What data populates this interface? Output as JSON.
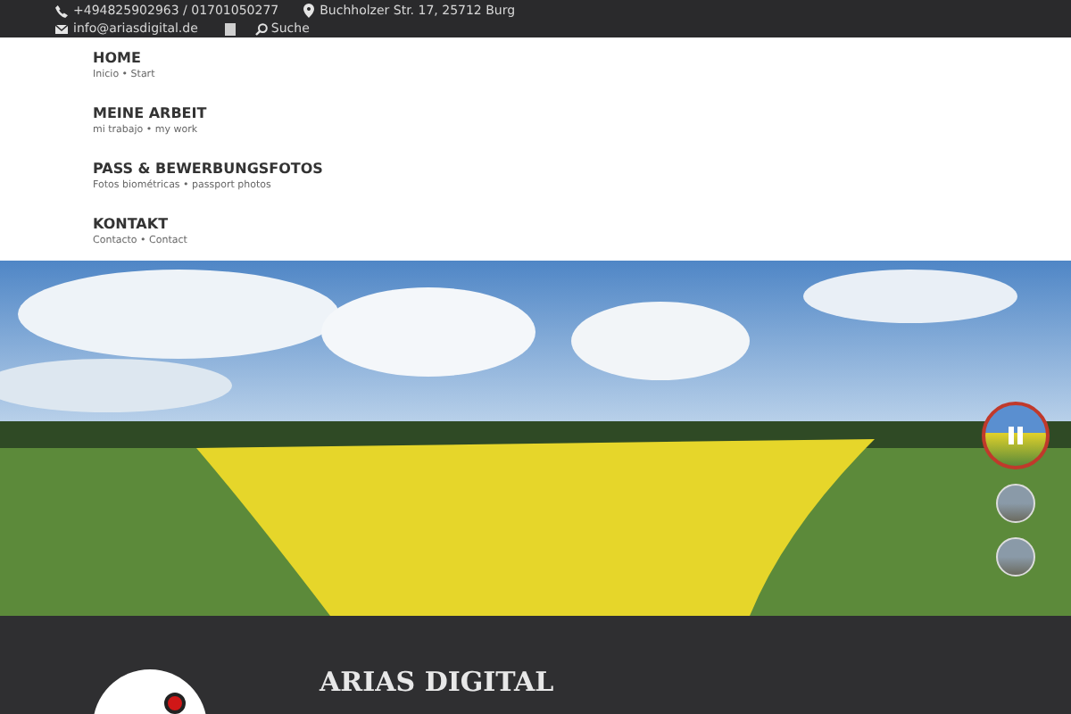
{
  "top_bar": {
    "phone": "+494825902963 / 01701050277",
    "address": "Buchholzer Str. 17, 25712 Burg",
    "email": "info@ariasdigital.de",
    "search": "Suche"
  },
  "nav": [
    {
      "title": "HOME",
      "subtitle": "Inicio • Start"
    },
    {
      "title": "MEINE ARBEIT",
      "subtitle": "mi trabajo • my work"
    },
    {
      "title": "PASS & BEWERBUNGSFOTOS",
      "subtitle": "Fotos biométricas • passport photos"
    },
    {
      "title": "KONTAKT",
      "subtitle": "Contacto • Contact"
    }
  ],
  "slider": {
    "thumbs": [
      {
        "selected": true
      },
      {
        "selected": false
      },
      {
        "selected": false
      }
    ]
  },
  "footer": {
    "title": "ARIAS DIGITAL"
  }
}
